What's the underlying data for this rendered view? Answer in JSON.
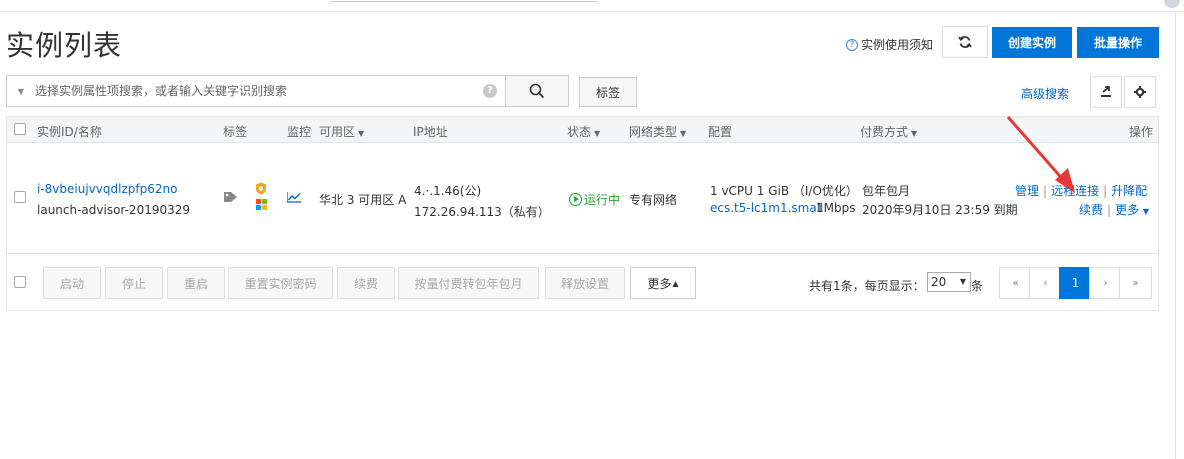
{
  "page": {
    "title": "实例列表"
  },
  "toolbar": {
    "help_label": "实例使用须知",
    "create_label": "创建实例",
    "batch_label": "批量操作"
  },
  "search": {
    "placeholder": "选择实例属性项搜索，或者输入关键字识别搜索",
    "tag_label": "标签",
    "advanced_label": "高级搜索"
  },
  "table": {
    "headers": {
      "id_name": "实例ID/名称",
      "tags": "标签",
      "monitor": "监控",
      "zone": "可用区",
      "ip": "IP地址",
      "status": "状态",
      "network": "网络类型",
      "config": "配置",
      "billing": "付费方式",
      "actions": "操作"
    },
    "rows": [
      {
        "instance_id": "i-8vbeiujvvqdlzpfp62no",
        "name": "launch-advisor-20190329",
        "zone": "华北 3 可用区 A",
        "public_ip": "4.·.1.46(公)",
        "private_ip": "172.26.94.113（私有）",
        "status": "运行中",
        "network": "专有网络",
        "config_main": "1 vCPU 1 GiB （I/O优化）",
        "instance_type": "ecs.t5-lc1m1.small",
        "bandwidth": "1Mbps",
        "billing_type": "包年包月",
        "expiry": "2020年9月10日 23:59 到期",
        "actions": {
          "manage": "管理",
          "remote": "远程连接",
          "upgrade": "升降配",
          "renew": "续费",
          "more": "更多"
        }
      }
    ]
  },
  "footer": {
    "buttons": [
      "启动",
      "停止",
      "重启",
      "重置实例密码",
      "续费",
      "按量付费转包年包月",
      "释放设置",
      "更多"
    ],
    "total_text": "共有1条，每页显示：",
    "page_size": "20",
    "page_size_unit": "条",
    "current_page": "1",
    "pager_first": "«",
    "pager_prev": "‹",
    "pager_next": "›",
    "pager_last": "»"
  },
  "colors": {
    "primary": "#0077d8",
    "link": "#0068c8",
    "running": "#22a52a",
    "annotation_arrow": "#e53935"
  }
}
